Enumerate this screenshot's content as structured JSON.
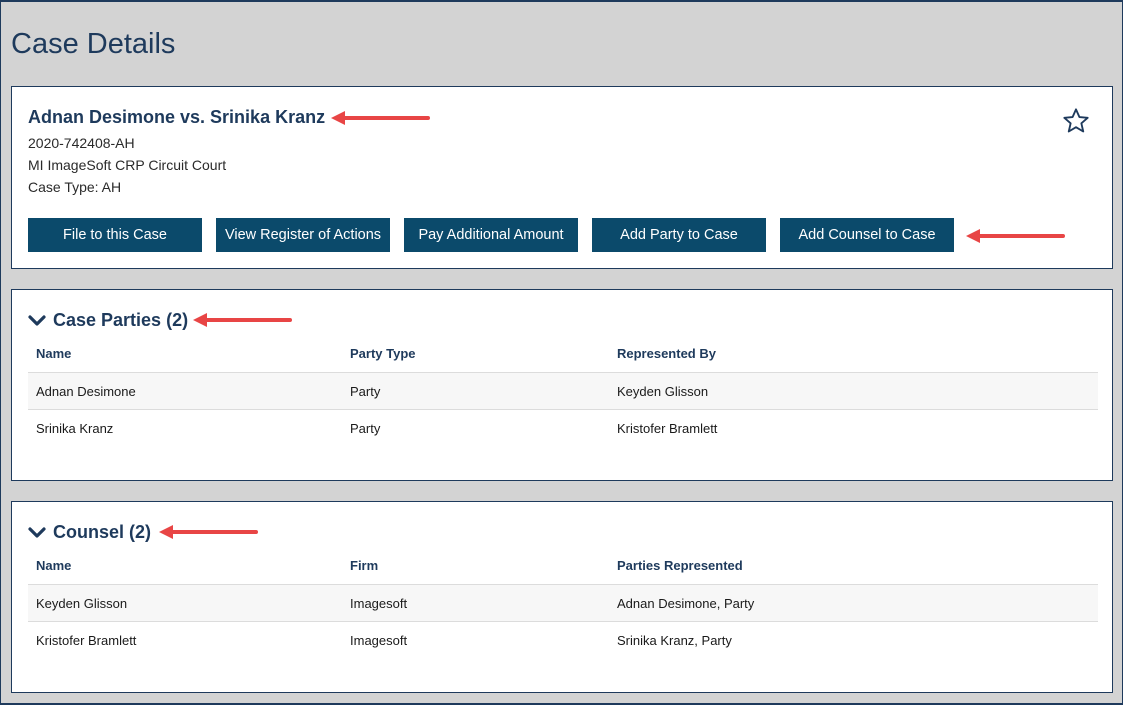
{
  "page": {
    "title": "Case Details"
  },
  "case": {
    "title": "Adnan Desimone vs. Srinika Kranz",
    "number": "2020-742408-AH",
    "court": "MI ImageSoft CRP Circuit Court",
    "type_line": "Case Type: AH",
    "favorite_icon": "star-outline-icon"
  },
  "actions": {
    "file": "File to this Case",
    "register": "View Register of Actions",
    "pay": "Pay Additional Amount",
    "add_party": "Add Party to Case",
    "add_counsel": "Add Counsel to Case"
  },
  "parties": {
    "title": "Case Parties (2)",
    "columns": [
      "Name",
      "Party Type",
      "Represented By"
    ],
    "rows": [
      [
        "Adnan Desimone",
        "Party",
        "Keyden Glisson"
      ],
      [
        "Srinika Kranz",
        "Party",
        "Kristofer Bramlett"
      ]
    ]
  },
  "counsel": {
    "title": "Counsel (2)",
    "columns": [
      "Name",
      "Firm",
      "Parties Represented"
    ],
    "rows": [
      [
        "Keyden Glisson",
        "Imagesoft",
        "Adnan Desimone, Party"
      ],
      [
        "Kristofer Bramlett",
        "Imagesoft",
        "Srinika Kranz, Party"
      ]
    ]
  },
  "colors": {
    "accent": "#0b4a6b",
    "heading": "#1e3a5c",
    "annotation_arrow": "#e84545"
  }
}
